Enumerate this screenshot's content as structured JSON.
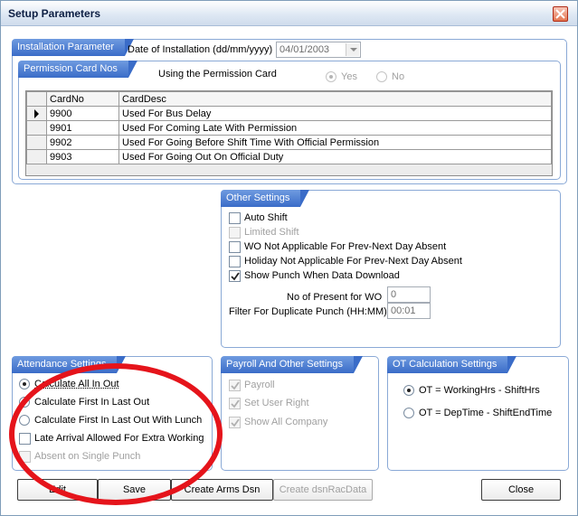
{
  "window": {
    "title": "Setup Parameters"
  },
  "installation": {
    "group_label": "Installation Parameter",
    "date_label": "Date of Installation (dd/mm/yyyy)",
    "date_value": "04/01/2003"
  },
  "permission_card": {
    "group_label": "Permission Card Nos",
    "using_label": "Using the Permission Card",
    "yes_label": "Yes",
    "no_label": "No",
    "selected": "Yes",
    "columns": [
      "CardNo",
      "CardDesc"
    ],
    "rows": [
      {
        "card_no": "9900",
        "desc": "Used For Bus Delay"
      },
      {
        "card_no": "9901",
        "desc": "Used For Coming Late With Permission"
      },
      {
        "card_no": "9902",
        "desc": "Used For Going Before Shift Time With Official Permission"
      },
      {
        "card_no": "9903",
        "desc": "Used For Going Out On Official Duty"
      }
    ]
  },
  "other_settings": {
    "group_label": "Other Settings",
    "auto_shift": "Auto Shift",
    "limited_shift": "Limited Shift",
    "wo_not_applicable": "WO Not Applicable For Prev-Next Day Absent",
    "holiday_not_applicable": "Holiday Not Applicable For Prev-Next Day Absent",
    "show_punch": "Show Punch When Data Download",
    "present_for_wo_label": "No of Present for WO",
    "present_for_wo_value": "0",
    "duplicate_punch_label": "Filter For Duplicate Punch (HH:MM)",
    "duplicate_punch_value": "00:01"
  },
  "attendance": {
    "group_label": "Attendance Settings",
    "calc_all": "Calculate All In  Out",
    "calc_first_last": "Calculate First In  Last Out",
    "calc_first_last_lunch": "Calculate First In  Last Out With Lunch",
    "late_arrival": "Late Arrival Allowed For Extra Working",
    "absent_single": "Absent on Single Punch"
  },
  "payroll": {
    "group_label": "Payroll And Other Settings",
    "payroll": "Payroll",
    "set_user_right": "Set User Right",
    "show_all_company": "Show All Company"
  },
  "ot": {
    "group_label": "OT Calculation Settings",
    "working_hrs": "OT = WorkingHrs - ShiftHrs",
    "dep_time": "OT = DepTime - ShiftEndTime"
  },
  "buttons": {
    "edit": "Edit",
    "save": "Save",
    "create_arms_dsn": "Create Arms Dsn",
    "create_dsn_rac": "Create dsnRacData",
    "close": "Close"
  },
  "colors": {
    "annotation": "#e5141b",
    "group_header": "#3a6cc8"
  }
}
